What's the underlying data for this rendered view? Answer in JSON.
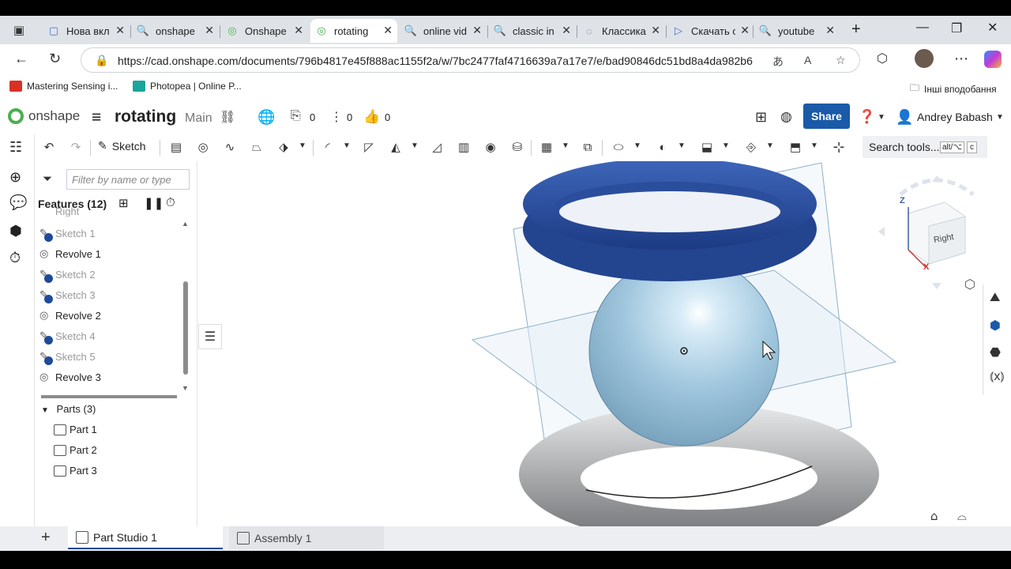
{
  "browser": {
    "tabs": [
      {
        "label": "Нова вкл",
        "icon": "new-tab-icon"
      },
      {
        "label": "onshape",
        "icon": "search-icon"
      },
      {
        "label": "Onshape",
        "icon": "onshape-icon"
      },
      {
        "label": "rotating",
        "icon": "onshape-icon",
        "active": true
      },
      {
        "label": "online vid",
        "icon": "search-icon"
      },
      {
        "label": "classic in",
        "icon": "search-icon"
      },
      {
        "label": "Классика",
        "icon": "page-icon"
      },
      {
        "label": "Скачать с",
        "icon": "play-icon"
      },
      {
        "label": "youtube",
        "icon": "search-icon"
      }
    ],
    "new_tab": "+",
    "url": "https://cad.onshape.com/documents/796b4817e45f888ac1155f2a/w/7bc2477faf4716639a7a17e7/e/bad90846dc51bd8a4da982b6",
    "bookmarks": [
      "Mastering Sensing i...",
      "Photopea | Online P..."
    ],
    "other_bookmarks": "Інші вподобання"
  },
  "app": {
    "logo": "onshape",
    "document_name": "rotating",
    "branch": "Main",
    "versions_count": "0",
    "branches_count": "0",
    "likes_count": "0",
    "share_label": "Share",
    "user_name": "Andrey Babash"
  },
  "toolbar": {
    "sketch_label": "Sketch",
    "search_tools_label": "Search tools...",
    "shortcut_1": "alt/⌥",
    "shortcut_2": "c"
  },
  "feature_panel": {
    "filter_placeholder": "Filter by name or type",
    "header": "Features",
    "count": "(12)",
    "partial_item": "Right",
    "features": [
      {
        "label": "Sketch 1",
        "type": "sketch"
      },
      {
        "label": "Revolve 1",
        "type": "revolve"
      },
      {
        "label": "Sketch 2",
        "type": "sketch"
      },
      {
        "label": "Sketch 3",
        "type": "sketch"
      },
      {
        "label": "Revolve 2",
        "type": "revolve"
      },
      {
        "label": "Sketch 4",
        "type": "sketch"
      },
      {
        "label": "Sketch 5",
        "type": "sketch"
      },
      {
        "label": "Revolve 3",
        "type": "revolve"
      }
    ],
    "parts_header": "Parts (3)",
    "parts": [
      "Part 1",
      "Part 2",
      "Part 3"
    ]
  },
  "view_cube": {
    "face": "Right",
    "axis_z": "Z",
    "axis_x": "X"
  },
  "bottom_tabs": [
    {
      "label": "Part Studio 1",
      "active": true
    },
    {
      "label": "Assembly 1",
      "active": false
    }
  ],
  "colors": {
    "accent": "#1a5aa8",
    "ring_top": "#2f56a8",
    "sphere": "#9cc4dc",
    "torus": "#a9abad"
  }
}
